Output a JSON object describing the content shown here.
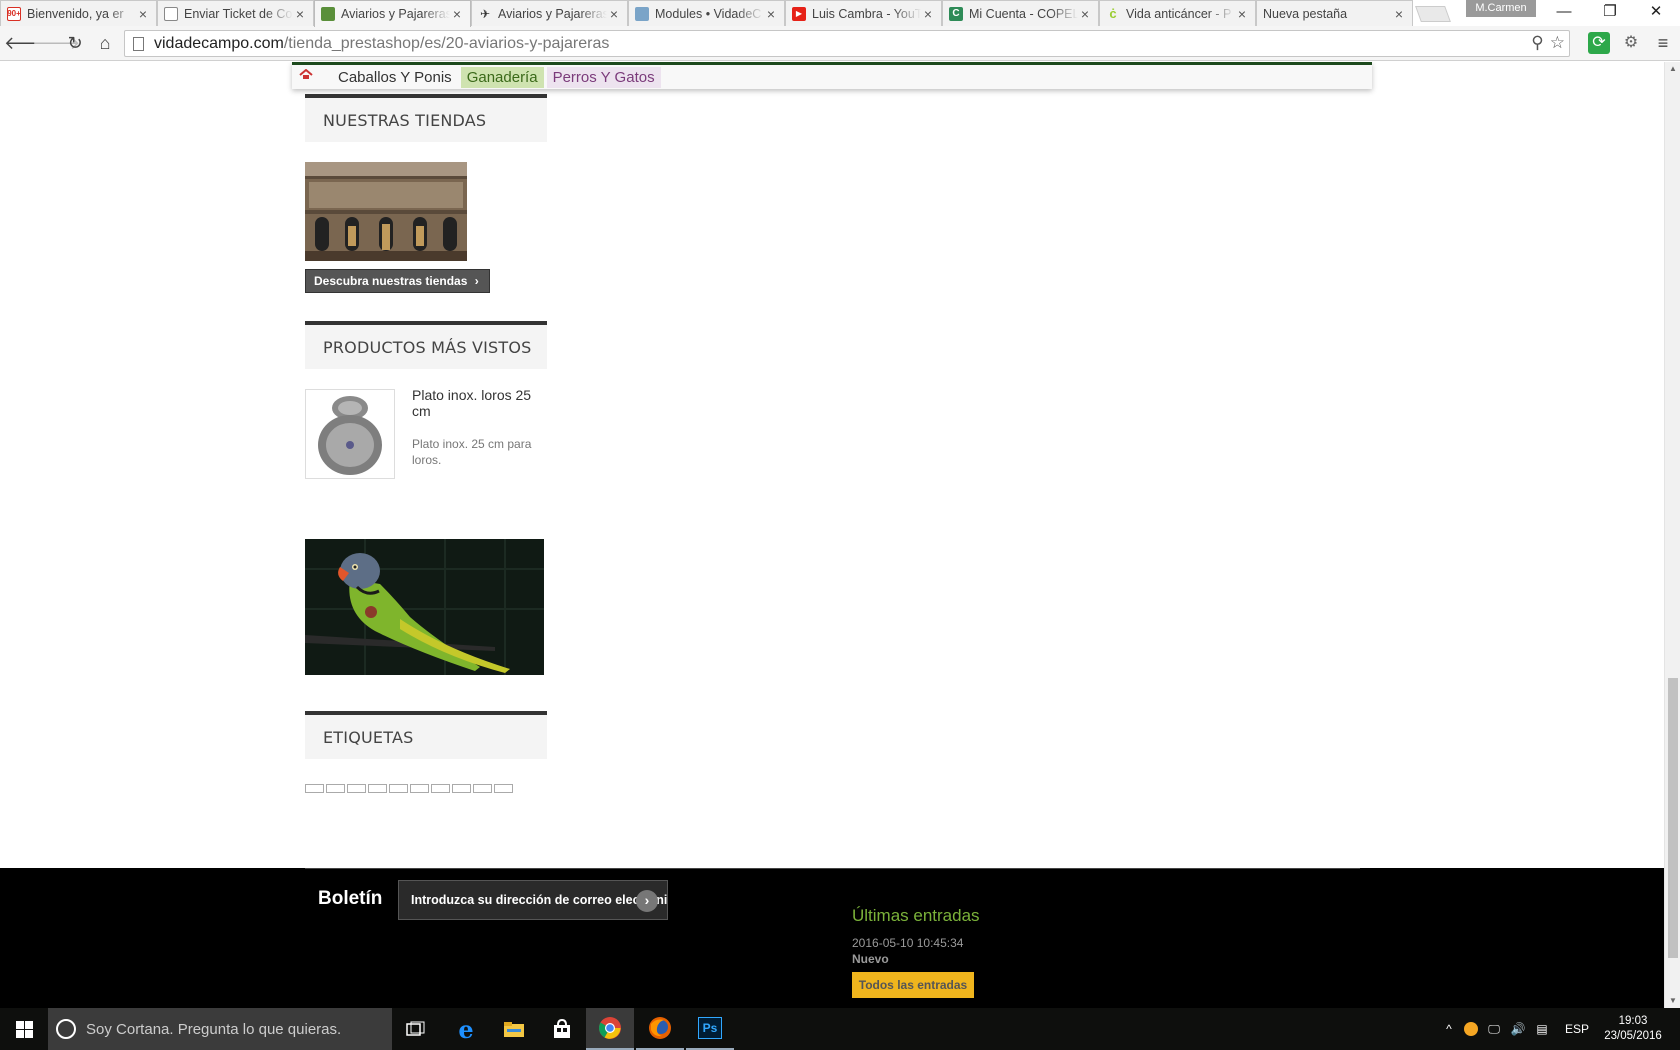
{
  "browser": {
    "tabs": [
      {
        "title": "Bienvenido, ya er",
        "icon": "gmail-icon",
        "badge": "90+",
        "color": "#d93025"
      },
      {
        "title": "Enviar Ticket de Co",
        "icon": "document-icon",
        "color": "#888888"
      },
      {
        "title": "Aviarios y Pajareras",
        "icon": "site-favicon",
        "color": "#5a8f3a",
        "active": true
      },
      {
        "title": "Aviarios y Pajareras",
        "icon": "bird-icon",
        "color": "#333333"
      },
      {
        "title": "Modules • VidadeC",
        "icon": "site-favicon",
        "color": "#5a8f3a"
      },
      {
        "title": "Luis Cambra - YouT",
        "icon": "youtube-icon",
        "color": "#e62117"
      },
      {
        "title": "Mi Cuenta - COPEL",
        "icon": "copel-icon",
        "color": "#2e8b57"
      },
      {
        "title": "Vida anticáncer - P",
        "icon": "leaf-icon",
        "color": "#9acd32"
      },
      {
        "title": "Nueva pestaña",
        "icon": "none",
        "color": "#ffffff"
      }
    ],
    "profile_name": "M.Carmen",
    "window_controls": {
      "minimize": "—",
      "restore": "❐",
      "close": "✕"
    },
    "url_host": "vidadecampo.com",
    "url_path": "/tienda_prestashop/es/20-aviarios-y-pajareras"
  },
  "page": {
    "top_nav": [
      "Caballos Y Ponis",
      "Ganadería",
      "Perros Y Gatos"
    ],
    "stores": {
      "heading": "NUESTRAS TIENDAS",
      "button_label": "Descubra nuestras tiendas",
      "button_icon": "chevron-right-icon"
    },
    "viewed": {
      "heading": "PRODUCTOS MÁS VISTOS",
      "product_name": "Plato inox. loros 25 cm",
      "product_desc": "Plato inox. 25 cm para loros."
    },
    "tags": {
      "heading": "ETIQUETAS",
      "count": 10
    },
    "footer": {
      "newsletter_title": "Boletín",
      "newsletter_placeholder": "Introduzca su dirección de correo electrónico",
      "latest_title": "Últimas entradas",
      "latest_date": "2016-05-10 10:45:34",
      "latest_item": "Nuevo",
      "latest_button": "Todos las entradas"
    }
  },
  "taskbar": {
    "search_placeholder": "Soy Cortana. Pregunta lo que quieras.",
    "apps": [
      "task-view-icon",
      "edge-icon",
      "file-explorer-icon",
      "store-icon",
      "chrome-icon",
      "firefox-icon",
      "photoshop-icon"
    ],
    "photoshop_label": "Ps",
    "language": "ESP",
    "time": "19:03",
    "date": "23/05/2016"
  },
  "colors": {
    "accent_green": "#7bb23a",
    "nav_border": "#1d4a1d",
    "button_yellow": "#f0b51d"
  }
}
